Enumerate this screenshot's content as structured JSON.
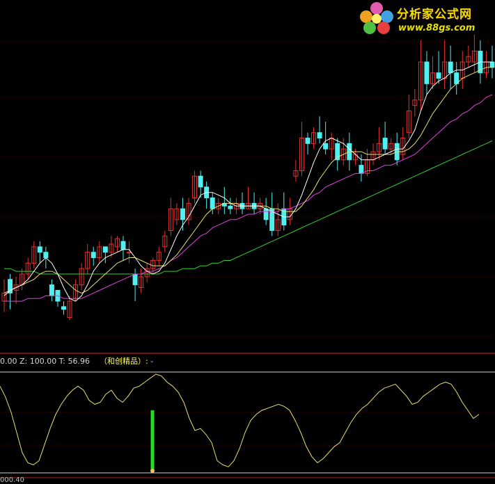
{
  "watermark": {
    "site_name": "分析家公式网",
    "site_url": "www.88gs.com"
  },
  "indicator_panel": {
    "label_prefix": "0.00",
    "z_label": "Z:",
    "z_value": "100.00",
    "t_label": "T:",
    "t_value": "56.96",
    "formula_name": "（和创精品）:",
    "formula_tail": "-",
    "bottom_value": "000.40"
  },
  "colors": {
    "background": "#000000",
    "up_candle": "#e83030",
    "down_candle": "#50f0f0",
    "ma_short": "#ffffff",
    "ma_mid": "#e8e070",
    "ma_purple": "#e040e0",
    "ma_long": "#30d030",
    "oscillator": "#e8e070",
    "signal_bar": "#20e020",
    "grid": "#5a0000",
    "separator": "#b02020"
  },
  "chart_data": [
    {
      "type": "candlestick",
      "title": "",
      "ylim": [
        0,
        100
      ],
      "candles": [
        [
          52,
          55,
          48,
          60
        ],
        [
          60,
          55,
          49,
          62
        ],
        [
          56,
          58,
          51,
          61
        ],
        [
          58,
          62,
          56,
          64
        ],
        [
          62,
          66,
          60,
          68
        ],
        [
          66,
          72,
          64,
          74
        ],
        [
          72,
          70,
          66,
          74
        ],
        [
          70,
          68,
          64,
          72
        ],
        [
          58,
          54,
          52,
          60
        ],
        [
          56,
          52,
          50,
          56
        ],
        [
          50,
          49,
          47,
          52
        ],
        [
          46,
          52,
          45,
          54
        ],
        [
          53,
          58,
          52,
          60
        ],
        [
          58,
          64,
          56,
          66
        ],
        [
          64,
          70,
          62,
          73
        ],
        [
          70,
          68,
          65,
          72
        ],
        [
          68,
          72,
          66,
          74
        ],
        [
          72,
          70,
          66,
          72
        ],
        [
          70,
          73,
          68,
          76
        ],
        [
          72,
          75,
          70,
          76
        ],
        [
          74,
          71,
          67,
          76
        ],
        [
          70,
          70,
          66,
          74
        ],
        [
          62,
          58,
          52,
          64
        ],
        [
          57,
          61,
          55,
          64
        ],
        [
          61,
          64,
          59,
          66
        ],
        [
          64,
          67,
          62,
          68
        ],
        [
          67,
          70,
          65,
          72
        ],
        [
          72,
          76,
          70,
          78
        ],
        [
          78,
          86,
          76,
          90
        ],
        [
          82,
          86,
          80,
          88
        ],
        [
          86,
          82,
          78,
          90
        ],
        [
          82,
          88,
          80,
          90
        ],
        [
          90,
          98,
          88,
          100
        ],
        [
          98,
          94,
          90,
          100
        ],
        [
          94,
          90,
          86,
          96
        ],
        [
          90,
          86,
          84,
          92
        ],
        [
          86,
          88,
          84,
          90
        ],
        [
          88,
          87,
          84,
          94
        ],
        [
          87,
          86,
          84,
          90
        ],
        [
          86,
          88,
          84,
          90
        ],
        [
          88,
          86,
          84,
          92
        ],
        [
          86,
          88,
          86,
          94
        ],
        [
          88,
          86,
          84,
          92
        ],
        [
          86,
          88,
          84,
          90
        ],
        [
          86,
          82,
          80,
          90
        ],
        [
          86,
          78,
          76,
          92
        ],
        [
          78,
          82,
          76,
          88
        ],
        [
          86,
          80,
          78,
          92
        ],
        [
          82,
          86,
          80,
          90
        ],
        [
          98,
          100,
          96,
          104
        ],
        [
          100,
          112,
          98,
          118
        ],
        [
          112,
          110,
          106,
          114
        ],
        [
          110,
          114,
          108,
          116
        ],
        [
          114,
          112,
          110,
          120
        ],
        [
          110,
          108,
          106,
          118
        ],
        [
          108,
          112,
          104,
          114
        ],
        [
          110,
          104,
          100,
          112
        ],
        [
          104,
          108,
          102,
          112
        ],
        [
          110,
          104,
          100,
          114
        ],
        [
          104,
          106,
          102,
          108
        ],
        [
          102,
          99,
          96,
          106
        ],
        [
          99,
          104,
          98,
          108
        ],
        [
          104,
          107,
          102,
          110
        ],
        [
          107,
          110,
          104,
          116
        ],
        [
          112,
          108,
          106,
          118
        ],
        [
          108,
          110,
          106,
          112
        ],
        [
          110,
          104,
          102,
          114
        ],
        [
          106,
          112,
          104,
          116
        ],
        [
          114,
          122,
          112,
          128
        ],
        [
          124,
          126,
          120,
          130
        ],
        [
          126,
          140,
          122,
          148
        ],
        [
          140,
          132,
          128,
          144
        ],
        [
          132,
          136,
          130,
          142
        ],
        [
          136,
          134,
          132,
          144
        ],
        [
          134,
          140,
          130,
          148
        ],
        [
          140,
          136,
          130,
          146
        ],
        [
          136,
          132,
          128,
          140
        ],
        [
          134,
          140,
          130,
          144
        ],
        [
          140,
          142,
          138,
          146
        ],
        [
          140,
          144,
          136,
          150
        ],
        [
          144,
          136,
          132,
          148
        ],
        [
          136,
          140,
          134,
          144
        ],
        [
          140,
          138,
          134,
          146
        ]
      ],
      "ma_short": [
        54,
        56,
        57,
        58,
        60,
        63,
        66,
        68,
        66,
        62,
        57,
        53,
        52,
        54,
        58,
        63,
        66,
        68,
        69,
        70,
        71,
        71,
        68,
        65,
        63,
        62,
        63,
        66,
        71,
        76,
        80,
        83,
        87,
        91,
        92,
        92,
        91,
        90,
        88,
        87,
        87,
        87,
        87,
        87,
        86,
        85,
        84,
        83,
        83,
        86,
        91,
        97,
        103,
        108,
        111,
        112,
        111,
        110,
        108,
        106,
        104,
        104,
        104,
        105,
        106,
        107,
        108,
        108,
        111,
        115,
        122,
        128,
        131,
        133,
        134,
        136,
        137,
        137,
        138,
        139,
        140,
        140,
        140
      ],
      "ma_mid": [
        55,
        56,
        57,
        58,
        59,
        60,
        62,
        63,
        63,
        62,
        60,
        58,
        56,
        55,
        56,
        58,
        60,
        62,
        64,
        66,
        67,
        68,
        68,
        67,
        66,
        65,
        65,
        65,
        67,
        69,
        72,
        75,
        78,
        81,
        84,
        86,
        87,
        88,
        88,
        88,
        87,
        87,
        87,
        87,
        87,
        86,
        86,
        85,
        85,
        85,
        87,
        90,
        93,
        97,
        100,
        103,
        105,
        106,
        107,
        107,
        107,
        106,
        106,
        106,
        106,
        106,
        107,
        107,
        108,
        110,
        113,
        117,
        121,
        124,
        127,
        130,
        132,
        134,
        135,
        136,
        137,
        138,
        138
      ],
      "ma_purple": [
        52,
        52,
        52,
        52,
        53,
        53,
        53,
        54,
        54,
        54,
        53,
        53,
        53,
        53,
        54,
        55,
        56,
        57,
        58,
        59,
        60,
        61,
        62,
        62,
        63,
        63,
        64,
        65,
        67,
        68,
        70,
        72,
        74,
        76,
        77,
        79,
        80,
        81,
        82,
        82,
        83,
        84,
        84,
        85,
        85,
        85,
        85,
        86,
        86,
        87,
        88,
        89,
        91,
        92,
        94,
        95,
        96,
        97,
        98,
        99,
        99,
        100,
        100,
        101,
        102,
        102,
        103,
        104,
        105,
        106,
        108,
        110,
        112,
        114,
        116,
        118,
        119,
        121,
        122,
        124,
        125,
        127,
        128
      ],
      "ma_long": [
        64,
        64,
        63,
        63,
        63,
        63,
        62,
        62,
        62,
        62,
        62,
        62,
        62,
        62,
        62,
        62,
        62,
        62,
        62,
        62,
        62,
        62,
        62,
        62,
        62,
        62,
        62,
        63,
        63,
        63,
        64,
        64,
        64,
        65,
        65,
        66,
        66,
        67,
        67,
        68,
        69,
        70,
        71,
        72,
        73,
        74,
        75,
        76,
        77,
        78,
        79,
        80,
        81,
        82,
        83,
        84,
        85,
        86,
        87,
        88,
        89,
        90,
        91,
        92,
        93,
        94,
        95,
        96,
        97,
        98,
        99,
        100,
        101,
        102,
        103,
        104,
        105,
        106,
        107,
        108,
        109,
        110,
        111
      ]
    },
    {
      "type": "line",
      "title": "",
      "ylim": [
        0,
        100
      ],
      "x": [
        0,
        8,
        16,
        24,
        32,
        40,
        48,
        56,
        64,
        72,
        80,
        88,
        96,
        104,
        112,
        120,
        128,
        136,
        144,
        152,
        160,
        168,
        176,
        184,
        192,
        200,
        208,
        216,
        224,
        232,
        240,
        248,
        256,
        264,
        272,
        280,
        288,
        296,
        304,
        312,
        320,
        328,
        336,
        344,
        352,
        360,
        368,
        376,
        384,
        392,
        400,
        408,
        416,
        424,
        432,
        440,
        448,
        456,
        464,
        472,
        480,
        488,
        496,
        504,
        512,
        520,
        528,
        536,
        544,
        552,
        560,
        568,
        576,
        584,
        592,
        600,
        608,
        616,
        624,
        632,
        640,
        648,
        656,
        664,
        672,
        680,
        688,
        696,
        704,
        711
      ],
      "values": [
        86,
        75,
        60,
        40,
        20,
        10,
        8,
        12,
        28,
        44,
        58,
        68,
        76,
        82,
        86,
        82,
        72,
        68,
        70,
        78,
        82,
        74,
        70,
        76,
        84,
        86,
        90,
        94,
        98,
        96,
        90,
        86,
        80,
        70,
        54,
        42,
        44,
        38,
        30,
        12,
        8,
        6,
        12,
        24,
        40,
        52,
        58,
        62,
        64,
        66,
        68,
        66,
        62,
        52,
        40,
        26,
        16,
        10,
        14,
        20,
        26,
        30,
        40,
        50,
        58,
        64,
        68,
        74,
        80,
        84,
        86,
        88,
        82,
        76,
        68,
        70,
        76,
        80,
        84,
        88,
        90,
        88,
        80,
        70,
        62,
        54,
        58
      ],
      "signal_bar": {
        "x": 219,
        "value": 62
      }
    }
  ]
}
